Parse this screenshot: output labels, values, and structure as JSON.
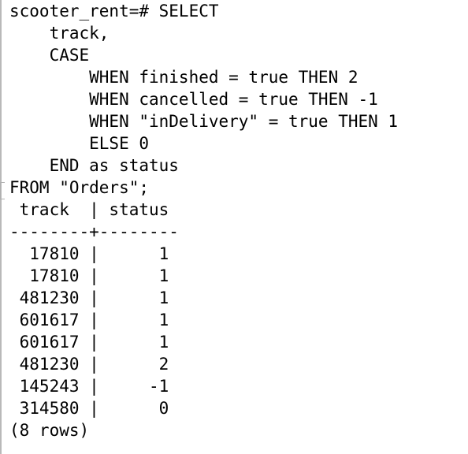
{
  "terminal": {
    "lines": [
      "scooter_rent=# SELECT",
      "    track,",
      "    CASE",
      "        WHEN finished = true THEN 2",
      "        WHEN cancelled = true THEN -1",
      "        WHEN \"inDelivery\" = true THEN 1",
      "        ELSE 0",
      "    END as status",
      "FROM \"Orders\";",
      " track  | status",
      "--------+--------",
      "  17810 |      1",
      "  17810 |      1",
      " 481230 |      1",
      " 601617 |      1",
      " 601617 |      1",
      " 481230 |      2",
      " 145243 |     -1",
      " 314580 |      0",
      "(8 rows)"
    ]
  }
}
